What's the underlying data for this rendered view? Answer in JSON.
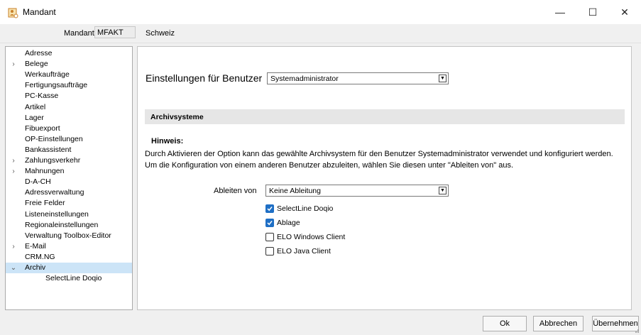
{
  "window": {
    "title": "Mandant",
    "minimize": "—",
    "maximize": "☐",
    "close": "✕"
  },
  "mandant": {
    "label": "Mandant",
    "code": "MFAKT",
    "name": "Schweiz"
  },
  "tree": [
    {
      "label": "Adresse",
      "expander": "",
      "level": 0
    },
    {
      "label": "Belege",
      "expander": ">",
      "level": 0
    },
    {
      "label": "Werkaufträge",
      "expander": "",
      "level": 0
    },
    {
      "label": "Fertigungsaufträge",
      "expander": "",
      "level": 0
    },
    {
      "label": "PC-Kasse",
      "expander": "",
      "level": 0
    },
    {
      "label": "Artikel",
      "expander": "",
      "level": 0
    },
    {
      "label": "Lager",
      "expander": "",
      "level": 0
    },
    {
      "label": "Fibuexport",
      "expander": "",
      "level": 0
    },
    {
      "label": "OP-Einstellungen",
      "expander": "",
      "level": 0
    },
    {
      "label": "Bankassistent",
      "expander": "",
      "level": 0
    },
    {
      "label": "Zahlungsverkehr",
      "expander": ">",
      "level": 0
    },
    {
      "label": "Mahnungen",
      "expander": ">",
      "level": 0
    },
    {
      "label": "D-A-CH",
      "expander": "",
      "level": 0
    },
    {
      "label": "Adressverwaltung",
      "expander": "",
      "level": 0
    },
    {
      "label": "Freie Felder",
      "expander": "",
      "level": 0
    },
    {
      "label": "Listeneinstellungen",
      "expander": "",
      "level": 0
    },
    {
      "label": "Regionaleinstellungen",
      "expander": "",
      "level": 0
    },
    {
      "label": "Verwaltung Toolbox-Editor",
      "expander": "",
      "level": 0
    },
    {
      "label": "E-Mail",
      "expander": ">",
      "level": 0
    },
    {
      "label": "CRM.NG",
      "expander": "",
      "level": 0
    },
    {
      "label": "Archiv",
      "expander": "v",
      "level": 0,
      "selected": true
    },
    {
      "label": "SelectLine Doqio",
      "expander": "",
      "level": 1
    }
  ],
  "settings": {
    "label": "Einstellungen für Benutzer",
    "user": "Systemadministrator"
  },
  "section": {
    "title": "Archivsysteme"
  },
  "hint": {
    "title": "Hinweis:",
    "text": "Durch Aktivieren der Option kann das gewählte Archivsystem für den Benutzer Systemadministrator verwendet und konfiguriert werden. Um die Konfiguration von einem anderen Benutzer abzuleiten, wählen Sie diesen unter \"Ableiten von\" aus."
  },
  "ableiten": {
    "label": "Ableiten von",
    "value": "Keine Ableitung"
  },
  "options": [
    {
      "label": "SelectLine Doqio",
      "checked": true
    },
    {
      "label": "Ablage",
      "checked": true
    },
    {
      "label": "ELO Windows Client",
      "checked": false
    },
    {
      "label": "ELO Java Client",
      "checked": false
    }
  ],
  "buttons": {
    "ok": "Ok",
    "cancel": "Abbrechen",
    "apply": "Übernehmen"
  },
  "colors": {
    "selection": "#cce4f7",
    "checkbox_checked": "#1f6fc5",
    "section_bg": "#e6e6e6"
  }
}
